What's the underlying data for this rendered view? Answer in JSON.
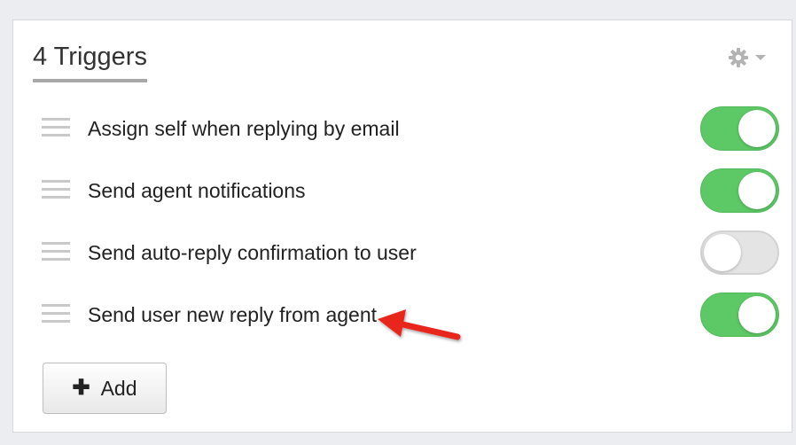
{
  "panel": {
    "title": "4 Triggers",
    "settings_icon": "gear-icon",
    "caret_icon": "caret-down-icon"
  },
  "triggers": [
    {
      "label": "Assign self when replying by email",
      "enabled": true
    },
    {
      "label": "Send agent notifications",
      "enabled": true
    },
    {
      "label": "Send auto-reply confirmation to user",
      "enabled": false
    },
    {
      "label": "Send user new reply from agent",
      "enabled": true
    }
  ],
  "add_button": {
    "icon": "plus-icon",
    "label": "Add"
  },
  "colors": {
    "toggle_on": "#5dc966",
    "toggle_off": "#e4e4e4",
    "annotation_arrow": "#e8281f"
  }
}
